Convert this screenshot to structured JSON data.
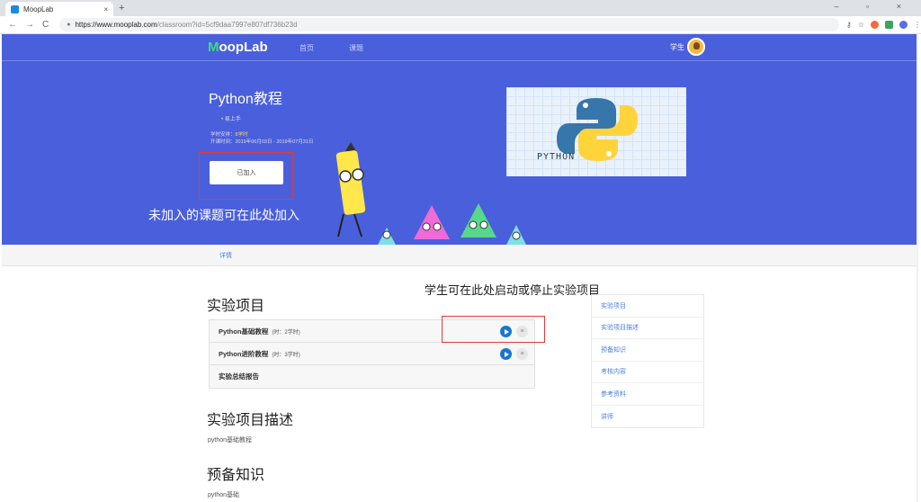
{
  "browser": {
    "tab_title": "MoopLab",
    "tab_close": "×",
    "new_tab": "+",
    "window_controls": "– ▫ ×",
    "url_host": "https://www.mooplab.com",
    "url_path": "/classroom?id=5cf9daa7997e807df736b23d",
    "nav": [
      "←",
      "→",
      "C"
    ]
  },
  "header": {
    "logo_m": "M",
    "logo_rest": "oopLab",
    "nav_home": "首页",
    "nav_course": "课题",
    "user_name": "学生"
  },
  "course": {
    "title": "Python教程",
    "bullet": "易上手",
    "hours_label": "学时安排：",
    "hours_value": "8学时",
    "open_time": "开课时间：2019年06月03日 - 2019年07月31日",
    "join_label": "已加入",
    "image_label": "PYTHON"
  },
  "annotations": {
    "join_hint": "未加入的课题可在此处加入",
    "control_hint": "学生可在此处启动或停止实验项目"
  },
  "subtabs": {
    "detail": "详情"
  },
  "projects": {
    "heading": "实验项目",
    "items": [
      {
        "name": "Python基础教程",
        "hours": "(时：2学时)",
        "has_controls": true
      },
      {
        "name": "Python进阶教程",
        "hours": "(时：3学时)",
        "has_controls": true
      },
      {
        "name": "实验总结报告",
        "hours": "",
        "has_controls": false
      }
    ]
  },
  "description": {
    "heading": "实验项目描述",
    "text": "python基础教程"
  },
  "prerequisites": {
    "heading": "预备知识",
    "text": "python基础"
  },
  "side_nav": [
    "实验项目",
    "实验项目描述",
    "预备知识",
    "考核内容",
    "参考资料",
    "讲师"
  ],
  "colors": {
    "hero": "#4a5fdc",
    "accent": "#4a7ee0",
    "logo_accent": "#3ddc84",
    "annotation_box": "#e53935"
  }
}
